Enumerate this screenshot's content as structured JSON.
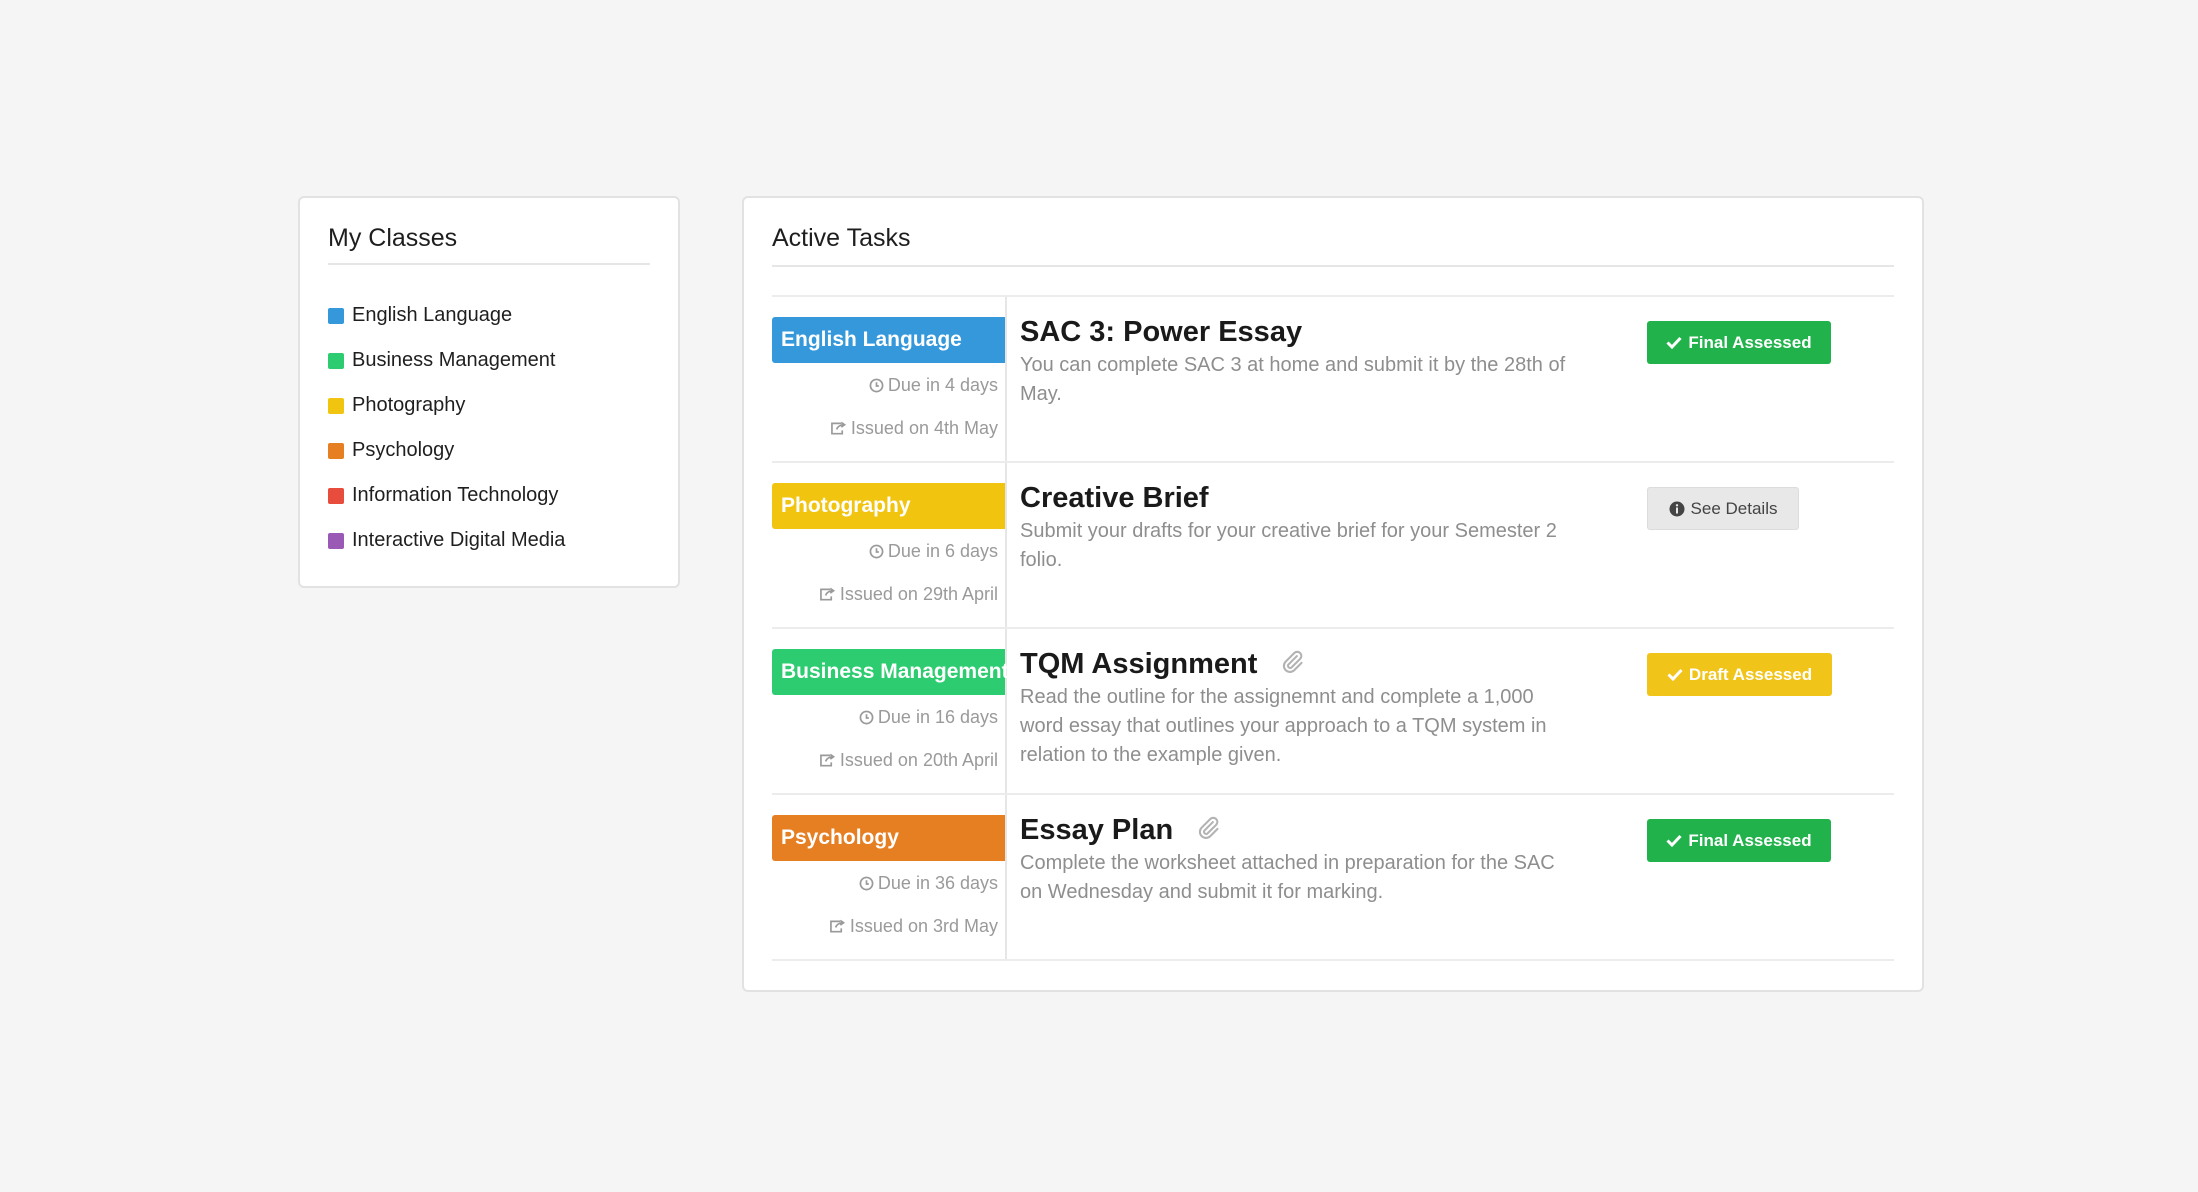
{
  "classes_panel": {
    "title": "My Classes",
    "items": [
      {
        "label": "English Language",
        "color": "#3498db"
      },
      {
        "label": "Business Management",
        "color": "#2ecc71"
      },
      {
        "label": "Photography",
        "color": "#f1c40f"
      },
      {
        "label": "Psychology",
        "color": "#e67e22"
      },
      {
        "label": "Information Technology",
        "color": "#e74c3c"
      },
      {
        "label": "Interactive Digital Media",
        "color": "#9b59b6"
      }
    ]
  },
  "tasks_panel": {
    "title": "Active Tasks",
    "tasks": [
      {
        "class_label": "English Language",
        "class_color": "#3498db",
        "due": "Due in 4 days",
        "issued": "Issued on 4th May",
        "title": "SAC 3: Power Essay",
        "has_attachment": false,
        "description": "You can complete SAC 3 at home and submit it by the 28th of May.",
        "status": {
          "label": "Final Assessed",
          "kind": "final",
          "icon": "check-icon"
        }
      },
      {
        "class_label": "Photography",
        "class_color": "#f1c40f",
        "due": "Due in 6 days",
        "issued": "Issued on 29th April",
        "title": "Creative Brief",
        "has_attachment": false,
        "description": "Submit your drafts for your creative brief for your Semester 2 folio.",
        "status": {
          "label": "See Details",
          "kind": "details",
          "icon": "info-icon"
        }
      },
      {
        "class_label": "Business Management",
        "class_color": "#2ecc71",
        "due": "Due in 16 days",
        "issued": "Issued on 20th April",
        "title": "TQM Assignment",
        "has_attachment": true,
        "description": "Read the outline for the assignemnt and complete a 1,000 word essay that outlines your approach to a TQM system in relation to the example given.",
        "status": {
          "label": "Draft Assessed",
          "kind": "draft",
          "icon": "check-icon"
        }
      },
      {
        "class_label": "Psychology",
        "class_color": "#e67e22",
        "due": "Due in 36 days",
        "issued": "Issued on 3rd May",
        "title": "Essay Plan",
        "has_attachment": true,
        "description": "Complete the worksheet attached in preparation for the SAC on Wednesday and submit it for marking.",
        "status": {
          "label": "Final Assessed",
          "kind": "final",
          "icon": "check-icon"
        }
      }
    ]
  }
}
